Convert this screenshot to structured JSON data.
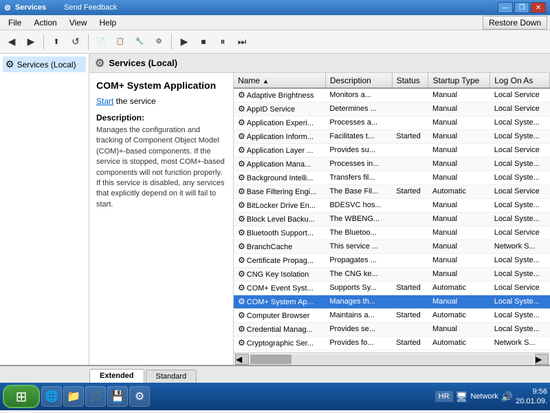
{
  "titlebar": {
    "title": "Services",
    "feedback_link": "Send Feedback",
    "controls": {
      "minimize": "—",
      "restore": "❐",
      "close": "✕"
    }
  },
  "menubar": {
    "items": [
      "File",
      "Action",
      "View",
      "Help"
    ]
  },
  "toolbar": {
    "restore_down_label": "Restore Down",
    "buttons": [
      "◀",
      "▶",
      "⬆",
      "⬇",
      "↺",
      "▶",
      "⏹",
      "⏸",
      "⏭"
    ]
  },
  "left_panel": {
    "tree_item": "Services (Local)"
  },
  "panel_header": {
    "title": "Services (Local)"
  },
  "service_info": {
    "title": "COM+ System Application",
    "start_label": "Start",
    "start_suffix": " the service",
    "desc_label": "Description:",
    "description": "Manages the configuration and tracking of Component Object Model (COM)+-based components. If the service is stopped, most COM+-based components will not function properly. If this service is disabled, any services that explicitly depend on it will fail to start."
  },
  "table": {
    "columns": [
      "Name",
      "Description",
      "Status",
      "Startup Type",
      "Log On As"
    ],
    "sort_col": 0,
    "rows": [
      {
        "icon": "⚙",
        "name": "Adaptive Brightness",
        "description": "Monitors a...",
        "status": "",
        "startup": "Manual",
        "logon": "Local Service"
      },
      {
        "icon": "⚙",
        "name": "AppID Service",
        "description": "Determines ...",
        "status": "",
        "startup": "Manual",
        "logon": "Local Service"
      },
      {
        "icon": "⚙",
        "name": "Application Experi...",
        "description": "Processes a...",
        "status": "",
        "startup": "Manual",
        "logon": "Local Syste..."
      },
      {
        "icon": "⚙",
        "name": "Application Inform...",
        "description": "Facilitates t...",
        "status": "Started",
        "startup": "Manual",
        "logon": "Local Syste..."
      },
      {
        "icon": "⚙",
        "name": "Application Layer ...",
        "description": "Provides su...",
        "status": "",
        "startup": "Manual",
        "logon": "Local Service"
      },
      {
        "icon": "⚙",
        "name": "Application Mana...",
        "description": "Processes in...",
        "status": "",
        "startup": "Manual",
        "logon": "Local Syste..."
      },
      {
        "icon": "⚙",
        "name": "Background Intelli...",
        "description": "Transfers fil...",
        "status": "",
        "startup": "Manual",
        "logon": "Local Syste..."
      },
      {
        "icon": "⚙",
        "name": "Base Filtering Engi...",
        "description": "The Base Fil...",
        "status": "Started",
        "startup": "Automatic",
        "logon": "Local Service"
      },
      {
        "icon": "⚙",
        "name": "BitLocker Drive En...",
        "description": "BDESVC hos...",
        "status": "",
        "startup": "Manual",
        "logon": "Local Syste..."
      },
      {
        "icon": "⚙",
        "name": "Block Level Backu...",
        "description": "The WBENG...",
        "status": "",
        "startup": "Manual",
        "logon": "Local Syste..."
      },
      {
        "icon": "⚙",
        "name": "Bluetooth Support...",
        "description": "The Bluetoo...",
        "status": "",
        "startup": "Manual",
        "logon": "Local Service"
      },
      {
        "icon": "⚙",
        "name": "BranchCache",
        "description": "This service ...",
        "status": "",
        "startup": "Manual",
        "logon": "Network S..."
      },
      {
        "icon": "⚙",
        "name": "Certificate Propag...",
        "description": "Propagates ...",
        "status": "",
        "startup": "Manual",
        "logon": "Local Syste..."
      },
      {
        "icon": "⚙",
        "name": "CNG Key Isolation",
        "description": "The CNG ke...",
        "status": "",
        "startup": "Manual",
        "logon": "Local Syste..."
      },
      {
        "icon": "⚙",
        "name": "COM+ Event Syst...",
        "description": "Supports Sy...",
        "status": "Started",
        "startup": "Automatic",
        "logon": "Local Service"
      },
      {
        "icon": "⚙",
        "name": "COM+ System Ap...",
        "description": "Manages th...",
        "status": "",
        "startup": "Manual",
        "logon": "Local Syste...",
        "selected": true
      },
      {
        "icon": "⚙",
        "name": "Computer Browser",
        "description": "Maintains a...",
        "status": "Started",
        "startup": "Automatic",
        "logon": "Local Syste..."
      },
      {
        "icon": "⚙",
        "name": "Credential Manag...",
        "description": "Provides se...",
        "status": "",
        "startup": "Manual",
        "logon": "Local Syste..."
      },
      {
        "icon": "⚙",
        "name": "Cryptographic Ser...",
        "description": "Provides fo...",
        "status": "Started",
        "startup": "Automatic",
        "logon": "Network S..."
      }
    ]
  },
  "tabs": [
    {
      "label": "Extended",
      "active": true
    },
    {
      "label": "Standard",
      "active": false
    }
  ],
  "taskbar": {
    "taskbar_icons": [
      "🌐",
      "📁",
      "🎵",
      "💾",
      "⚙"
    ],
    "locale": "HR",
    "tray_icons": [
      "📶",
      "🔊"
    ],
    "time": "9:56",
    "date": "20.01.09."
  }
}
